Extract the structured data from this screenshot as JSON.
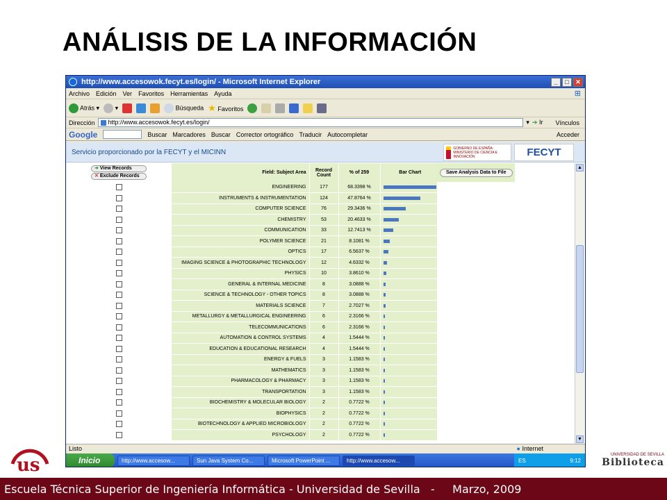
{
  "slide": {
    "title": "ANÁLISIS DE LA INFORMACIÓN",
    "footer": "Escuela Técnica Superior de Ingeniería Informática - Universidad de Sevilla   -     Marzo, 2009",
    "logo_text": "UNIVERSIDAD DE SEVILLA",
    "bib_small": "UNIVERSIDAD DE SEVILLA",
    "bib_big": "Biblioteca"
  },
  "browser": {
    "title": "http://www.accesowok.fecyt.es/login/ - Microsoft Internet Explorer",
    "menu": [
      "Archivo",
      "Edición",
      "Ver",
      "Favoritos",
      "Herramientas",
      "Ayuda"
    ],
    "toolbar": {
      "back": "Atrás",
      "search": "Búsqueda",
      "favorites": "Favoritos"
    },
    "address_label": "Dirección",
    "address": "http://www.accesowok.fecyt.es/login/",
    "go": "Ir",
    "links": "Vínculos",
    "google": {
      "logo": "Google",
      "search_btn": "Buscar",
      "bookmarks": "Marcadores",
      "search2": "Buscar",
      "spell": "Corrector ortográfico",
      "translate": "Traducir",
      "autofill": "Autocompletar",
      "signin": "Acceder"
    },
    "status": "Listo",
    "zone": "Internet"
  },
  "page": {
    "banner": "Servicio proporcionado por la FECYT y el MICINN",
    "gob": "GOBIERNO DE ESPAÑA · MINISTERIO DE CIENCIA E INNOVACIÓN",
    "fecyt": "FECYT",
    "view_records": "View Records",
    "exclude_records": "Exclude Records",
    "col_field": "Field: Subject Area",
    "col_count": "Record Count",
    "col_pct": "% of 259",
    "col_bar": "Bar Chart",
    "save": "Save Analysis Data to File"
  },
  "chart_data": {
    "type": "bar",
    "categories": [
      "ENGINEERING",
      "INSTRUMENTS & INSTRUMENTATION",
      "COMPUTER SCIENCE",
      "CHEMISTRY",
      "COMMUNICATION",
      "POLYMER SCIENCE",
      "OPTICS",
      "IMAGING SCIENCE & PHOTOGRAPHIC TECHNOLOGY",
      "PHYSICS",
      "GENERAL & INTERNAL MEDICINE",
      "SCIENCE & TECHNOLOGY - OTHER TOPICS",
      "MATERIALS SCIENCE",
      "METALLURGY & METALLURGICAL ENGINEERING",
      "TELECOMMUNICATIONS",
      "AUTOMATION & CONTROL SYSTEMS",
      "EDUCATION & EDUCATIONAL RESEARCH",
      "ENERGY & FUELS",
      "MATHEMATICS",
      "PHARMACOLOGY & PHARMACY",
      "TRANSPORTATION",
      "BIOCHEMISTRY & MOLECULAR BIOLOGY",
      "BIOPHYSICS",
      "BIOTECHNOLOGY & APPLIED MICROBIOLOGY",
      "PSYCHOLOGY"
    ],
    "values": [
      177,
      124,
      76,
      53,
      33,
      21,
      17,
      12,
      10,
      8,
      8,
      7,
      6,
      6,
      4,
      4,
      3,
      3,
      3,
      3,
      2,
      2,
      2,
      2
    ],
    "percent": [
      "68.3398 %",
      "47.8764 %",
      "29.3436 %",
      "20.4633 %",
      "12.7413 %",
      "8.1081 %",
      "6.5637 %",
      "4.6332 %",
      "3.8610 %",
      "3.0888 %",
      "3.0888 %",
      "2.7027 %",
      "2.3166 %",
      "2.3166 %",
      "1.5444 %",
      "1.5444 %",
      "1.1583 %",
      "1.1583 %",
      "1.1583 %",
      "1.1583 %",
      "0.7722 %",
      "0.7722 %",
      "0.7722 %",
      "0.7722 %"
    ],
    "title": "",
    "xlabel": "",
    "ylabel": "",
    "colors": {
      "bar": "#4a77c0"
    }
  }
}
